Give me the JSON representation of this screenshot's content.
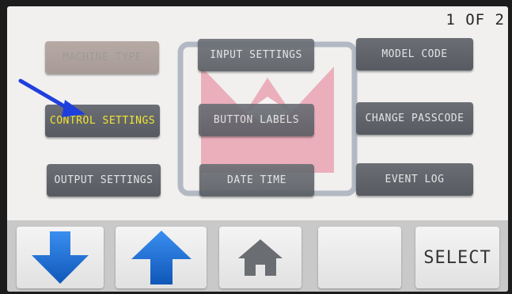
{
  "header": {
    "page_indicator": "1 OF 2"
  },
  "menu": {
    "machine_type": "MACHINE TYPE",
    "input_settings": "INPUT SETTINGS",
    "model_code": "MODEL CODE",
    "control_settings": "CONTROL SETTINGS",
    "button_labels": "BUTTON LABELS",
    "change_passcode": "CHANGE PASSCODE",
    "output_settings": "OUTPUT SETTINGS",
    "date_time": "DATE TIME",
    "event_log": "EVENT LOG"
  },
  "nav": {
    "down_icon": "arrow-down-icon",
    "up_icon": "arrow-up-icon",
    "home_icon": "home-icon",
    "select_label": "SELECT"
  },
  "colors": {
    "button_gray": "#616569",
    "selected_text": "#f1e333",
    "arrow_blue": "#1a6fd8",
    "logo_pink": "#ebafbb",
    "pointer_blue": "#1f3fdd"
  }
}
